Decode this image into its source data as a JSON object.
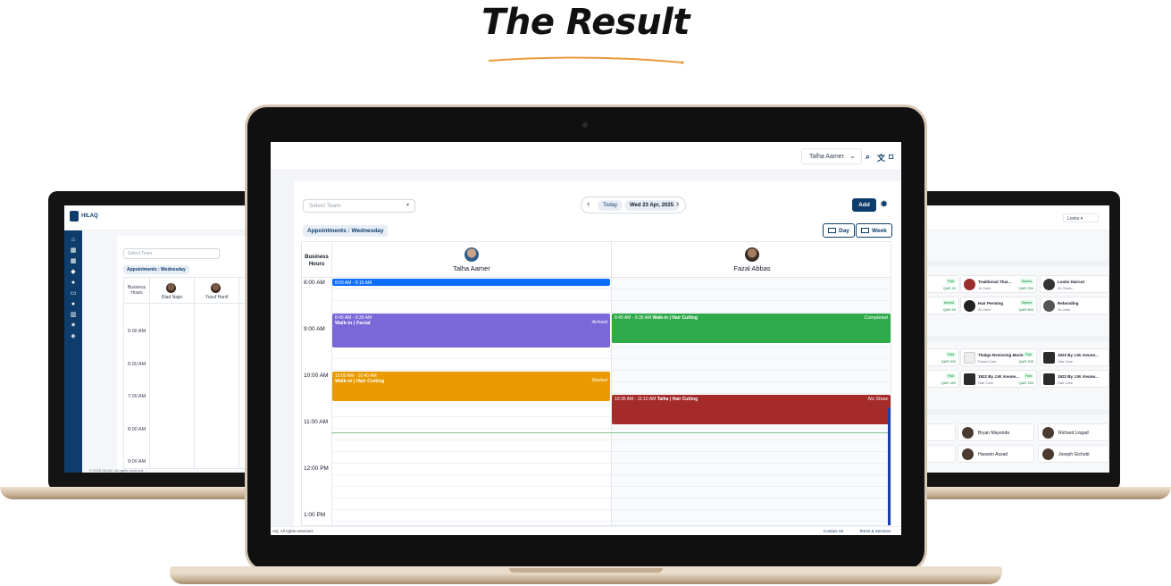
{
  "headline": "The Result",
  "colors": {
    "accent_underline": "#e89a3c",
    "brand": "#0f3d6b",
    "purple": "#7b68d8",
    "green": "#2eaa4a",
    "orange": "#e89a00",
    "red": "#a52a2a",
    "blue": "#0d6efd"
  },
  "left_screen": {
    "brand": "HILAQ",
    "select_placeholder": "Select Team",
    "section_badge": "Appointments : Wednesday",
    "business_hours_label": "Business Hours",
    "columns": [
      "Riad Najei",
      "Yusuf Hanif"
    ],
    "times": [
      "5:00 AM",
      "6:00 AM",
      "7:00 AM",
      "8:00 AM",
      "9:00 AM"
    ],
    "footer": "© 2025 HILAQ. All rights reserved.",
    "sidebar_icons": [
      "home-icon",
      "calendar-icon",
      "calendar-icon",
      "tag-icon",
      "user-icon",
      "id-card-icon",
      "users-icon",
      "chart-icon",
      "gear-icon",
      "shield-icon"
    ]
  },
  "center_screen": {
    "user_menu": "Talha Aamer",
    "select_placeholder": "Select Team",
    "today_label": "Today",
    "date_label": "Wed 23 Apr, 2025",
    "add_label": "Add",
    "section_badge": "Appointments : Wednesday",
    "view_day": "Day",
    "view_week": "Week",
    "business_hours_label": "Business Hours",
    "staff": [
      {
        "name": "Talha Aamer"
      },
      {
        "name": "Fazal Abbas"
      }
    ],
    "times": [
      "8:00 AM",
      "9:00 AM",
      "10:00 AM",
      "11:00 AM",
      "12:00 PM",
      "1:00 PM"
    ],
    "appointments": [
      {
        "staff": 0,
        "time": "8:00 AM - 8:15 AM",
        "title": "",
        "status": "",
        "color": "#0d6efd"
      },
      {
        "staff": 0,
        "time": "8:45 AM - 9:30 AM",
        "title": "Walk-in | Facial",
        "status": "Arrived",
        "color": "#7b68d8"
      },
      {
        "staff": 1,
        "time": "8:45 AM - 9:35 AM",
        "title": "Walk-in | Hair Cutting",
        "status": "Completed",
        "color": "#2eaa4a"
      },
      {
        "staff": 0,
        "time": "10:00 AM - 10:40 AM",
        "title": "Walk-in | Hair Cutting",
        "status": "Started",
        "color": "#e89a00"
      },
      {
        "staff": 1,
        "time": "10:30 AM - 11:10 AM",
        "title": "Talha | Hair Cutting",
        "status": "No Show",
        "color": "#a52a2a"
      }
    ],
    "footer_left": "AQ. All rights reserved.",
    "footer_links": [
      "Contact Us",
      "Terms & Services"
    ]
  },
  "right_screen": {
    "user_menu": "Looks",
    "service_cards": [
      {
        "name": "Traditional Thai...",
        "dur": "1h 0min",
        "tag": "Paid",
        "price": "QAR 40"
      },
      {
        "name": "Looks Haircut",
        "dur": "0h 30min",
        "tag": "Started",
        "price": "QAR 250"
      },
      {
        "name": "Hair Perming",
        "dur": "2h 0min",
        "tag": "Arrived",
        "price": "QAR 50"
      },
      {
        "name": "Rebonding",
        "dur": "1h 0min",
        "tag": "Started",
        "price": "QAR 800"
      },
      {
        "name": "Thalgo Revivving Marin...",
        "dur": "Facial Care",
        "tag": "Paid",
        "price": "QAR 200"
      },
      {
        "name": "1922 By J.M. Keune...",
        "dur": "Hair Care",
        "tag": "Paid",
        "price": "QAR 200"
      },
      {
        "name": "1922 By J.M. Keune...",
        "dur": "Hair Care",
        "tag": "Paid",
        "price": "QAR 150"
      },
      {
        "name": "1922 By J.M. Keune...",
        "dur": "Hair Care",
        "tag": "Paid",
        "price": "QAR 150"
      }
    ],
    "people": [
      "Bryan Mayonda",
      "Richard Lingad",
      "Hassein Assad",
      "Joseph Gichobi"
    ]
  }
}
